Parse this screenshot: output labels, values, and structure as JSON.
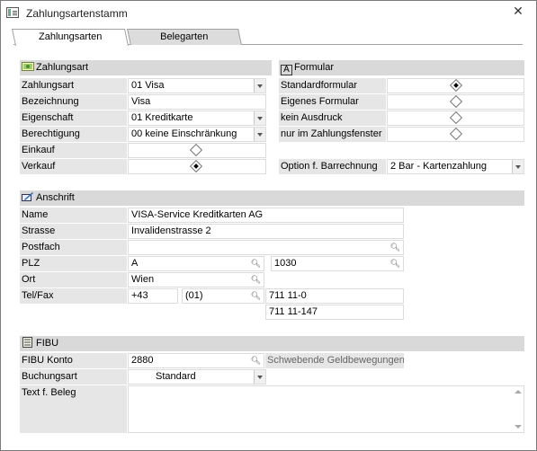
{
  "window": {
    "title": "Zahlungsartenstamm",
    "close_glyph": "✕"
  },
  "tabs": [
    {
      "label": "Zahlungsarten",
      "active": true
    },
    {
      "label": "Belegarten",
      "active": false
    }
  ],
  "zahlungsart": {
    "header": "Zahlungsart",
    "rows": {
      "zahlungsart": {
        "label": "Zahlungsart",
        "value": "01 Visa"
      },
      "bezeichnung": {
        "label": "Bezeichnung",
        "value": "Visa"
      },
      "eigenschaft": {
        "label": "Eigenschaft",
        "value": "01 Kreditkarte"
      },
      "berechtigung": {
        "label": "Berechtigung",
        "value": "00 keine Einschränkung"
      },
      "einkauf": {
        "label": "Einkauf",
        "checked": false
      },
      "verkauf": {
        "label": "Verkauf",
        "checked": true
      }
    }
  },
  "formular": {
    "header": "Formular",
    "icon_letter": "A",
    "rows": {
      "standard": {
        "label": "Standardformular",
        "checked": true
      },
      "eigenes": {
        "label": "Eigenes Formular",
        "checked": false
      },
      "kein": {
        "label": "kein Ausdruck",
        "checked": false
      },
      "nur": {
        "label": "nur im Zahlungsfenster",
        "checked": false
      }
    },
    "barrechnung": {
      "label": "Option f. Barrechnung",
      "value": "2 Bar - Kartenzahlung"
    }
  },
  "anschrift": {
    "header": "Anschrift",
    "name": {
      "label": "Name",
      "value": "VISA-Service Kreditkarten AG"
    },
    "strasse": {
      "label": "Strasse",
      "value": "Invalidenstrasse 2"
    },
    "postfach": {
      "label": "Postfach",
      "value": ""
    },
    "plz": {
      "label": "PLZ",
      "country": "A",
      "code": "1030"
    },
    "ort": {
      "label": "Ort",
      "value": "Wien"
    },
    "telfax": {
      "label": "Tel/Fax",
      "country_code": "+43",
      "area": "(01)",
      "tel": "711 11-0",
      "fax": "711 11-147"
    }
  },
  "fibu": {
    "header": "FIBU",
    "konto": {
      "label": "FIBU Konto",
      "value": "2880",
      "hint": "Schwebende Geldbewegungen"
    },
    "buchungsart": {
      "label": "Buchungsart",
      "value": "Standard"
    },
    "text": {
      "label": "Text f. Beleg",
      "value": ""
    }
  },
  "icons": {
    "search": "search-icon",
    "dropdown": "chevron-down-icon"
  }
}
